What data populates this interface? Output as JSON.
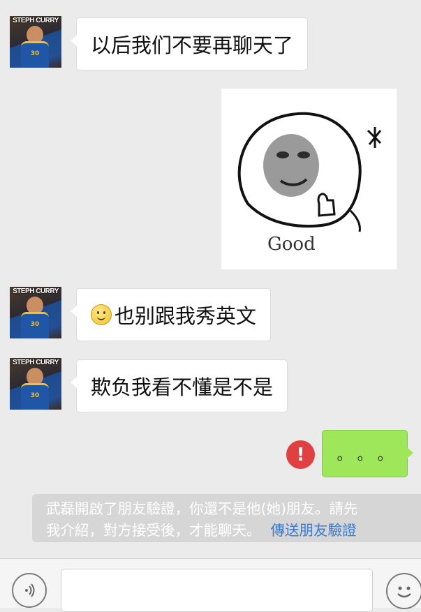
{
  "avatar_text": "STEPH CURRY",
  "jersey_number": "30",
  "messages": {
    "msg1": "以后我们不要再聊天了",
    "sticker_text": "Good",
    "msg2": "也别跟我秀英文",
    "msg3": "欺负我看不懂是不是",
    "sent_dots": "。。。"
  },
  "error_badge": "!",
  "system": {
    "line1": "武磊開啟了朋友驗證，你還不是他(她)朋友。請先",
    "line2": "我介紹，對方接受後，才能聊天。",
    "link": "傳送朋友驗證"
  },
  "colors": {
    "sent_bubble": "#9ee65a",
    "error": "#e04140",
    "link": "#3a7ad0"
  },
  "icons": [
    "voice-icon",
    "emoji-icon",
    "smile-emoji-icon",
    "error-icon"
  ]
}
